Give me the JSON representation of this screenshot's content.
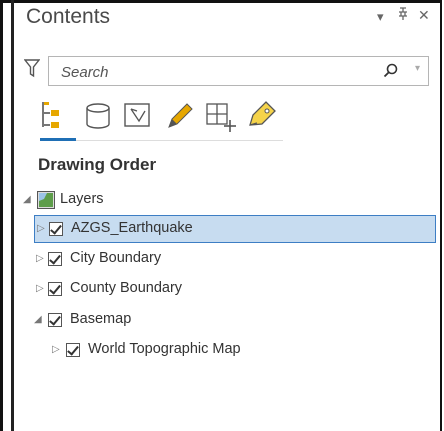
{
  "window": {
    "title": "Contents",
    "menu_glyph": "▾",
    "pin_glyph": "ᵻ",
    "close_glyph": "✕"
  },
  "search": {
    "placeholder": "Search"
  },
  "section_title": "Drawing Order",
  "views": [
    {
      "name": "list-by-drawing-order",
      "selected": true
    },
    {
      "name": "list-by-data-source",
      "selected": false
    },
    {
      "name": "list-by-selection",
      "selected": false
    },
    {
      "name": "list-by-editing",
      "selected": false
    },
    {
      "name": "list-by-snapping",
      "selected": false
    },
    {
      "name": "list-by-labeling",
      "selected": false
    }
  ],
  "tree": {
    "root": "Layers",
    "items": [
      {
        "label": "AZGS_Earthquake",
        "checked": true,
        "selected": true
      },
      {
        "label": "City Boundary",
        "checked": true
      },
      {
        "label": "County Boundary",
        "checked": true
      },
      {
        "label": "Basemap",
        "checked": true,
        "expanded": true
      },
      {
        "label": "World Topographic Map",
        "checked": true
      }
    ]
  },
  "colors": {
    "accent": "#1f6fb5",
    "selection_fill": "#c7dcf0",
    "selection_border": "#3d7ec4"
  }
}
